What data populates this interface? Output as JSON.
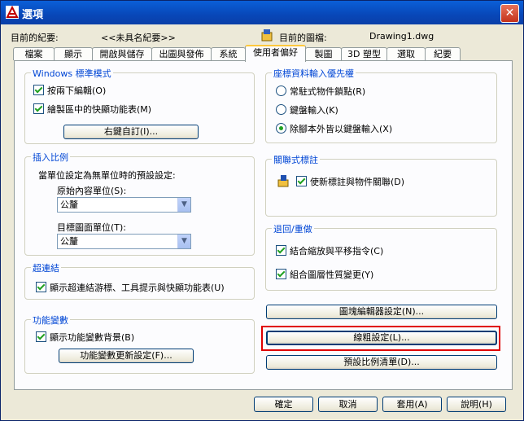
{
  "window": {
    "title": "選項"
  },
  "info": {
    "profile_label": "目前的紀要:",
    "profile_value": "<<未具名紀要>>",
    "drawing_label": "目前的圖檔:",
    "drawing_value": "Drawing1.dwg"
  },
  "tabs": [
    {
      "label": "檔案"
    },
    {
      "label": "顯示"
    },
    {
      "label": "開啟與儲存"
    },
    {
      "label": "出圖與發佈"
    },
    {
      "label": "系統"
    },
    {
      "label": "使用者偏好",
      "active": true
    },
    {
      "label": "製圖"
    },
    {
      "label": "3D 塑型"
    },
    {
      "label": "選取"
    },
    {
      "label": "紀要"
    }
  ],
  "windows_group": {
    "title": "Windows 標準模式",
    "double_click_edit": "按兩下編輯(O)",
    "shortcut_menu": "繪製區中的快顯功能表(M)",
    "right_click_button": "右鍵自訂(I)..."
  },
  "insert_scale": {
    "title": "插入比例",
    "description": "當單位設定為無單位時的預設設定:",
    "source_label": "原始內容單位(S):",
    "source_value": "公釐",
    "target_label": "目標圖面單位(T):",
    "target_value": "公釐"
  },
  "hyperlink": {
    "title": "超連結",
    "show_cursor": "顯示超連結游標、工具提示與快顯功能表(U)"
  },
  "fields": {
    "title": "功能變數",
    "show_background": "顯示功能變數背景(B)",
    "update_button": "功能變數更新設定(F)..."
  },
  "coordinate_priority": {
    "title": "座標資料輸入優先權",
    "options": [
      "常駐式物件鎖點(R)",
      "鍵盤輸入(K)",
      "除腳本外皆以鍵盤輸入(X)"
    ],
    "selected_index": 2
  },
  "associative_dim": {
    "title": "關聯式標註",
    "make_associative": "使新標註與物件關聯(D)"
  },
  "undo_redo": {
    "title": "退回/重做",
    "combine_zoom": "結合縮放與平移指令(C)",
    "combine_layer": "組合圖層性質變更(Y)"
  },
  "buttons": {
    "block_editor": "圖塊編輯器設定(N)...",
    "lineweight": "線粗設定(L)...",
    "scale_list": "預設比例清單(D)..."
  },
  "footer": {
    "ok": "確定",
    "cancel": "取消",
    "apply": "套用(A)",
    "help": "說明(H)"
  }
}
